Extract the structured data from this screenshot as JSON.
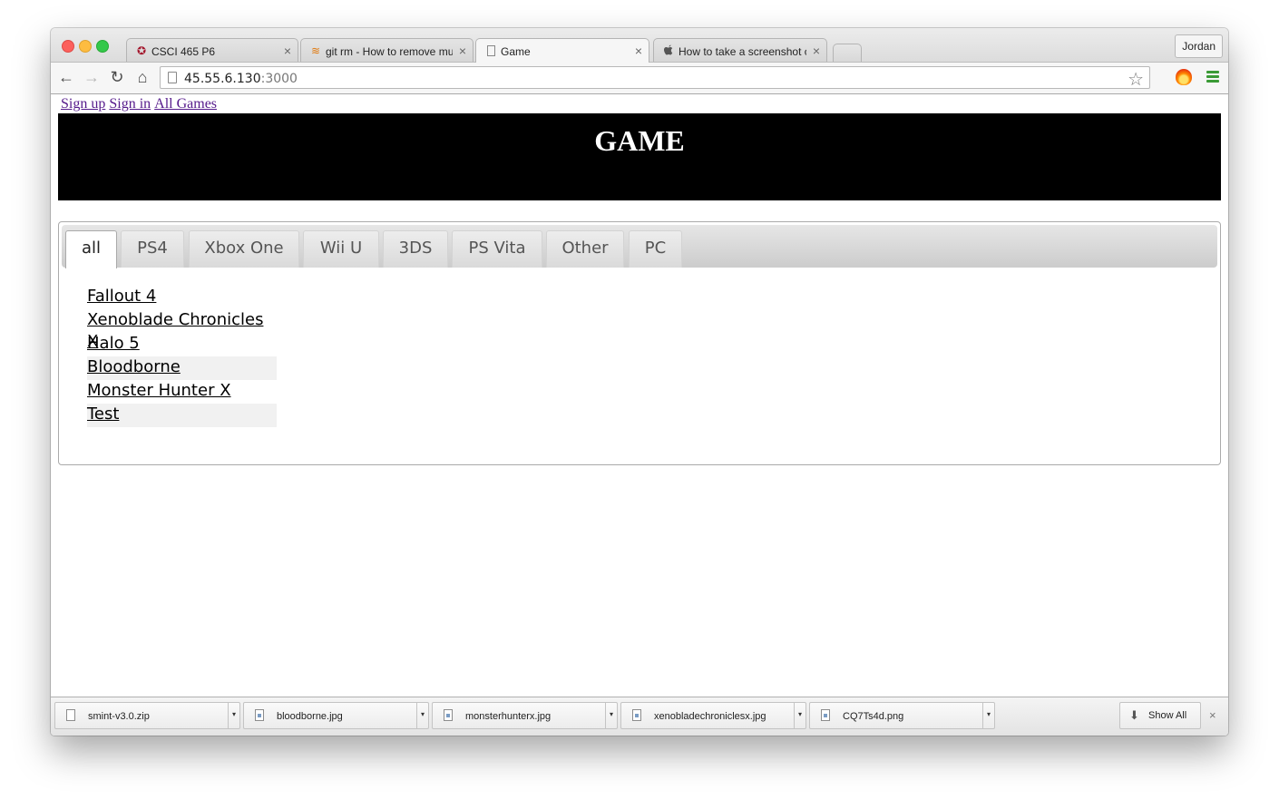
{
  "browser": {
    "tabs": [
      {
        "title": "CSCI 465 P6",
        "favicon": "✪"
      },
      {
        "title": "git rm - How to remove mu",
        "favicon": "≋"
      },
      {
        "title": "Game",
        "favicon": ""
      },
      {
        "title": "How to take a screenshot c",
        "favicon": ""
      }
    ],
    "profile_name": "Jordan",
    "url_host": "45.55.6.130",
    "url_port": ":3000",
    "icons": {
      "back": "←",
      "forward": "→",
      "reload": "↻",
      "home": "⌂",
      "star": "☆",
      "close": "×"
    }
  },
  "page": {
    "top_links": [
      "Sign up",
      "Sign in",
      "All Games"
    ],
    "title": "GAME",
    "tabs": [
      "all",
      "PS4",
      "Xbox One",
      "Wii U",
      "3DS",
      "PS Vita",
      "Other",
      "PC"
    ],
    "active_tab": "all",
    "games": [
      "Fallout 4",
      "Xenoblade Chronicles X",
      "Halo 5",
      "Bloodborne",
      "Monster Hunter X",
      "Test"
    ]
  },
  "downloads": {
    "items": [
      "smint-v3.0.zip",
      "bloodborne.jpg",
      "monsterhunterx.jpg",
      "xenobladechroniclesx.jpg",
      "CQ7Ts4d.png"
    ],
    "menu_glyph": "▾",
    "show_all_label": "Show All",
    "show_all_icon": "⬇",
    "close": "×"
  },
  "colors": {
    "hero_bg": "#000000",
    "hero_text": "#ffffff",
    "visited_link": "#551a8b",
    "menu_green": "#3a9a35"
  }
}
